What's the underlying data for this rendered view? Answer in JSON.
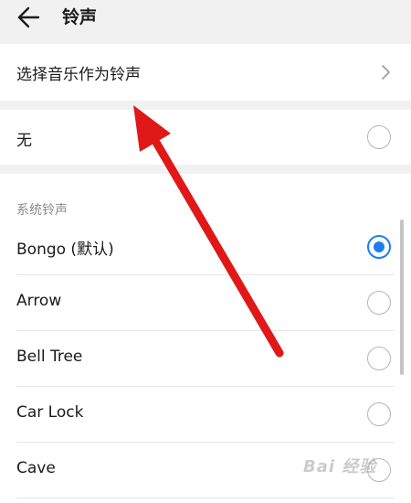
{
  "header": {
    "title": "铃声"
  },
  "music_option": {
    "label": "选择音乐作为铃声"
  },
  "none_option": {
    "label": "无",
    "selected": false
  },
  "system_ringtones": {
    "section_title": "系统铃声",
    "items": [
      {
        "label": "Bongo (默认)",
        "selected": true
      },
      {
        "label": "Arrow",
        "selected": false
      },
      {
        "label": "Bell Tree",
        "selected": false
      },
      {
        "label": "Car Lock",
        "selected": false
      },
      {
        "label": "Cave",
        "selected": false
      }
    ]
  },
  "watermark": {
    "text": "Bai 经验"
  },
  "colors": {
    "accent": "#1e7df0",
    "annotation_arrow": "#e01818"
  }
}
